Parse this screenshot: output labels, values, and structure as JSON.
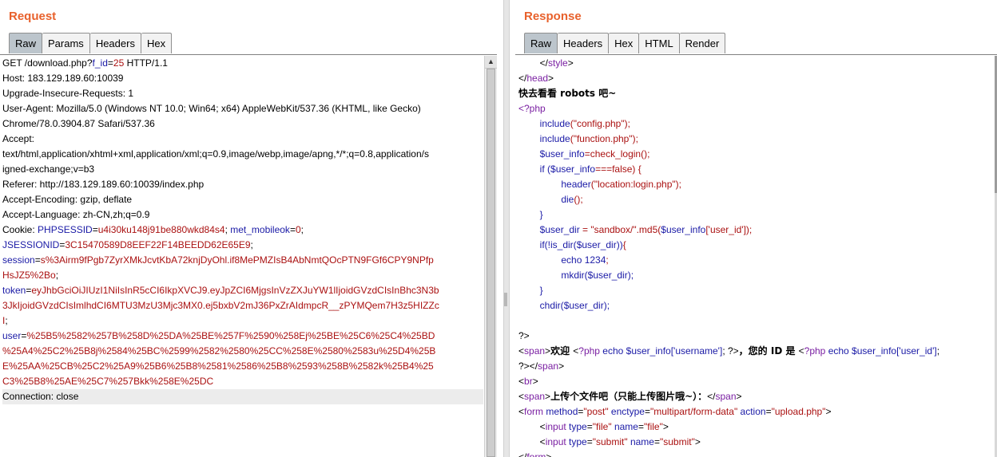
{
  "request": {
    "title": "Request",
    "tabs": [
      "Raw",
      "Params",
      "Headers",
      "Hex"
    ],
    "active_tab": "Raw",
    "lines": [
      [
        [
          "t",
          "GET /download.php?"
        ],
        [
          "k",
          "f_id"
        ],
        [
          "t",
          "="
        ],
        [
          "v",
          "25"
        ],
        [
          "t",
          " HTTP/1.1"
        ]
      ],
      [
        [
          "t",
          "Host: 183.129.189.60:10039"
        ]
      ],
      [
        [
          "t",
          "Upgrade-Insecure-Requests: 1"
        ]
      ],
      [
        [
          "t",
          "User-Agent: Mozilla/5.0 (Windows NT 10.0; Win64; x64) AppleWebKit/537.36 (KHTML, like Gecko)"
        ]
      ],
      [
        [
          "t",
          "Chrome/78.0.3904.87 Safari/537.36"
        ]
      ],
      [
        [
          "t",
          "Accept:"
        ]
      ],
      [
        [
          "t",
          "text/html,application/xhtml+xml,application/xml;q=0.9,image/webp,image/apng,*/*;q=0.8,application/s"
        ]
      ],
      [
        [
          "t",
          "igned-exchange;v=b3"
        ]
      ],
      [
        [
          "t",
          "Referer: http://183.129.189.60:10039/index.php"
        ]
      ],
      [
        [
          "t",
          "Accept-Encoding: gzip, deflate"
        ]
      ],
      [
        [
          "t",
          "Accept-Language: zh-CN,zh;q=0.9"
        ]
      ],
      [
        [
          "t",
          "Cookie: "
        ],
        [
          "k",
          "PHPSESSID"
        ],
        [
          "t",
          "="
        ],
        [
          "v",
          "u4i30ku148j91be880wkd84s4"
        ],
        [
          "t",
          "; "
        ],
        [
          "k",
          "met_mobileok"
        ],
        [
          "t",
          "="
        ],
        [
          "v",
          "0"
        ],
        [
          "t",
          ";"
        ]
      ],
      [
        [
          "k",
          "JSESSIONID"
        ],
        [
          "t",
          "="
        ],
        [
          "v",
          "3C15470589D8EEF22F14BEEDD62E65E9"
        ],
        [
          "t",
          ";"
        ]
      ],
      [
        [
          "k",
          "session"
        ],
        [
          "t",
          "="
        ],
        [
          "v",
          "s%3Airm9fPgb7ZyrXMkJcvtKbA72knjDyOhl.if8MePMZIsB4AbNmtQOcPTN9FGf6CPY9NPfp"
        ]
      ],
      [
        [
          "v",
          "HsJZ5%2Bo"
        ],
        [
          "t",
          ";"
        ]
      ],
      [
        [
          "k",
          "token"
        ],
        [
          "t",
          "="
        ],
        [
          "v",
          "eyJhbGciOiJIUzI1NiIsInR5cCI6IkpXVCJ9.eyJpZCI6MjgsInVzZXJuYW1lIjoidGVzdCIsInBhc3N3b"
        ]
      ],
      [
        [
          "v",
          "3JkIjoidGVzdCIsImlhdCI6MTU3MzU3Mjc3MX0.ej5bxbV2mJ36PxZrAIdmpcR__zPYMQem7H3z5HIZZc"
        ]
      ],
      [
        [
          "v",
          "I"
        ],
        [
          "t",
          ";"
        ]
      ],
      [
        [
          "k",
          "user"
        ],
        [
          "t",
          "="
        ],
        [
          "v",
          "%25B5%2582%257B%258D%25DA%25BE%257F%2590%258Ej%25BE%25C6%25C4%25BD"
        ]
      ],
      [
        [
          "v",
          "%25A4%25C2%25B8j%2584%25BC%2599%2582%2580%25CC%258E%2580%2583u%25D4%25B"
        ]
      ],
      [
        [
          "v",
          "E%25AA%25CB%25C2%25A9%25B6%25B8%2581%2586%25B8%2593%258B%2582k%25B4%25"
        ]
      ],
      [
        [
          "v",
          "C3%25B8%25AE%25C7%257Bkk%258E%25DC"
        ]
      ],
      [
        [
          "t",
          "Connection: close"
        ]
      ]
    ]
  },
  "response": {
    "title": "Response",
    "tabs": [
      "Raw",
      "Headers",
      "Hex",
      "HTML",
      "Render"
    ],
    "active_tab": "Raw",
    "lines": [
      [
        [
          "t",
          "        </"
        ],
        [
          "p",
          "style"
        ],
        [
          "t",
          ">"
        ]
      ],
      [
        [
          "t",
          "</"
        ],
        [
          "p",
          "head"
        ],
        [
          "t",
          ">"
        ]
      ],
      [
        [
          "b",
          "快去看看 robots 吧~"
        ]
      ],
      [
        [
          "p",
          "<?php"
        ]
      ],
      [
        [
          "t",
          "        "
        ],
        [
          "k",
          "include"
        ],
        [
          "v",
          "(\"config.php\");"
        ]
      ],
      [
        [
          "t",
          "        "
        ],
        [
          "k",
          "include"
        ],
        [
          "v",
          "(\"function.php\");"
        ]
      ],
      [
        [
          "t",
          "        "
        ],
        [
          "k",
          "$user_info"
        ],
        [
          "v",
          "=check_login();"
        ]
      ],
      [
        [
          "t",
          "        "
        ],
        [
          "k",
          "if ("
        ],
        [
          "k",
          "$user_info"
        ],
        [
          "v",
          "===false) {"
        ]
      ],
      [
        [
          "t",
          "                "
        ],
        [
          "k",
          "header"
        ],
        [
          "v",
          "(\"location:login.php\");"
        ]
      ],
      [
        [
          "t",
          "                "
        ],
        [
          "k",
          "die"
        ],
        [
          "v",
          "();"
        ]
      ],
      [
        [
          "t",
          "        "
        ],
        [
          "k",
          "}"
        ]
      ],
      [
        [
          "t",
          "        "
        ],
        [
          "k",
          "$user_dir"
        ],
        [
          "v",
          " = \"sandbox/\".md5("
        ],
        [
          "k",
          "$user_info"
        ],
        [
          "v",
          "['user_id']);"
        ]
      ],
      [
        [
          "t",
          "        "
        ],
        [
          "k",
          "if(!is_dir("
        ],
        [
          "k",
          "$user_dir"
        ],
        [
          "k",
          "))"
        ],
        [
          "v",
          "{"
        ]
      ],
      [
        [
          "t",
          "                "
        ],
        [
          "k",
          "echo 1234"
        ],
        [
          "v",
          ";"
        ]
      ],
      [
        [
          "t",
          "                "
        ],
        [
          "k",
          "mkdir("
        ],
        [
          "k",
          "$user_dir"
        ],
        [
          "k",
          ");"
        ]
      ],
      [
        [
          "t",
          "        "
        ],
        [
          "k",
          "}"
        ]
      ],
      [
        [
          "t",
          "        "
        ],
        [
          "k",
          "chdir("
        ],
        [
          "k",
          "$user_dir"
        ],
        [
          "k",
          ");"
        ]
      ],
      [
        [
          "t",
          ""
        ]
      ],
      [
        [
          "t",
          "?>"
        ]
      ],
      [
        [
          "t",
          "<"
        ],
        [
          "p",
          "span"
        ],
        [
          "t",
          ">"
        ],
        [
          "b",
          "欢迎 "
        ],
        [
          "t",
          "<"
        ],
        [
          "p",
          "?php"
        ],
        [
          "k",
          " echo $user_info['username']"
        ],
        [
          "t",
          "; ?>"
        ],
        [
          "b",
          "，您的 ID 是 "
        ],
        [
          "t",
          "<"
        ],
        [
          "p",
          "?php"
        ],
        [
          "k",
          " echo $user_info['user_id']"
        ],
        [
          "t",
          ";"
        ]
      ],
      [
        [
          "t",
          "?></"
        ],
        [
          "p",
          "span"
        ],
        [
          "t",
          ">"
        ]
      ],
      [
        [
          "t",
          "<"
        ],
        [
          "p",
          "br"
        ],
        [
          "t",
          ">"
        ]
      ],
      [
        [
          "t",
          "<"
        ],
        [
          "p",
          "span"
        ],
        [
          "t",
          ">"
        ],
        [
          "b",
          "上传个文件吧（只能上传图片哦~）："
        ],
        [
          "t",
          "</"
        ],
        [
          "p",
          "span"
        ],
        [
          "t",
          ">"
        ]
      ],
      [
        [
          "t",
          "<"
        ],
        [
          "p",
          "form"
        ],
        [
          "k",
          " method"
        ],
        [
          "t",
          "="
        ],
        [
          "v",
          "\"post\""
        ],
        [
          "k",
          " enctype"
        ],
        [
          "t",
          "="
        ],
        [
          "v",
          "\"multipart/form-data\""
        ],
        [
          "k",
          " action"
        ],
        [
          "t",
          "="
        ],
        [
          "v",
          "\"upload.php\""
        ],
        [
          "t",
          ">"
        ]
      ],
      [
        [
          "t",
          "        <"
        ],
        [
          "p",
          "input"
        ],
        [
          "k",
          " type"
        ],
        [
          "t",
          "="
        ],
        [
          "v",
          "\"file\""
        ],
        [
          "k",
          " name"
        ],
        [
          "t",
          "="
        ],
        [
          "v",
          "\"file\""
        ],
        [
          "t",
          ">"
        ]
      ],
      [
        [
          "t",
          "        <"
        ],
        [
          "p",
          "input"
        ],
        [
          "k",
          " type"
        ],
        [
          "t",
          "="
        ],
        [
          "v",
          "\"submit\""
        ],
        [
          "k",
          " name"
        ],
        [
          "t",
          "="
        ],
        [
          "v",
          "\"submit\""
        ],
        [
          "t",
          ">"
        ]
      ],
      [
        [
          "t",
          "</"
        ],
        [
          "p",
          "form"
        ],
        [
          "t",
          ">"
        ]
      ]
    ]
  },
  "colors": {
    "title": "#e8612c",
    "key": "#1a1aa6",
    "value": "#aa1111",
    "tag": "#7a1fa2",
    "active_tab_bg": "#bcc5cc"
  }
}
